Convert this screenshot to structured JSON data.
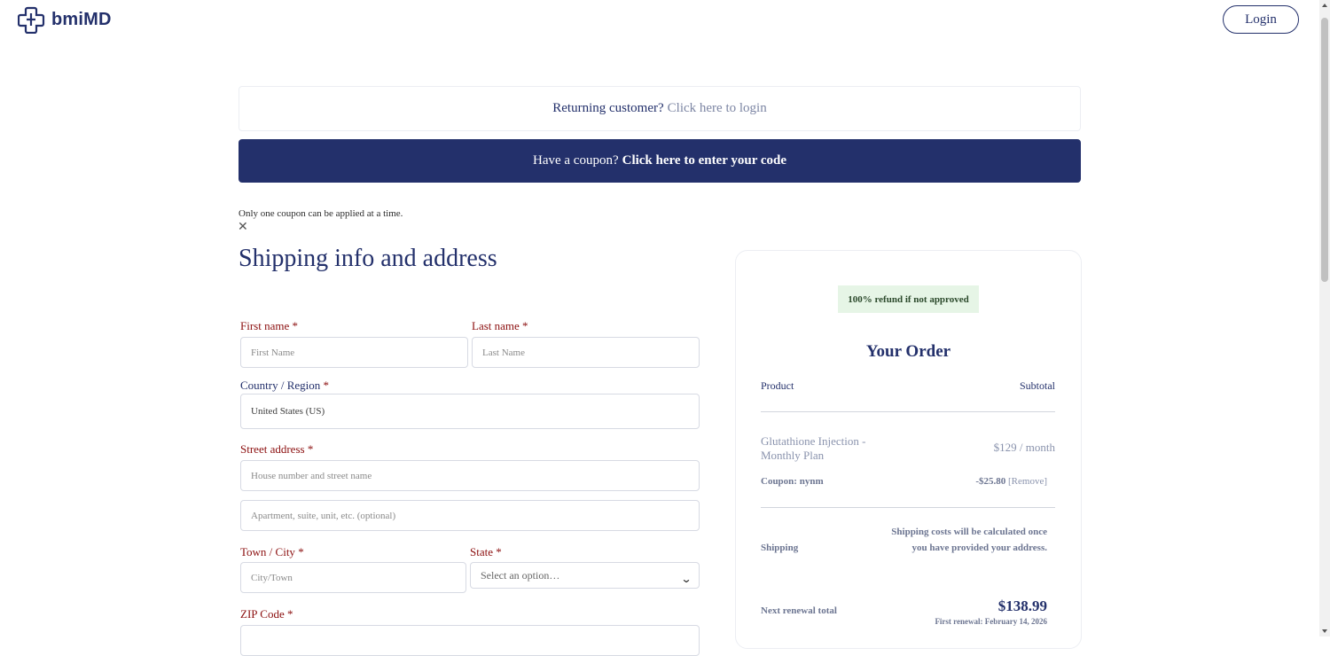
{
  "brand": {
    "name": "bmiMD",
    "logo_color": "#23306b"
  },
  "header": {
    "login_label": "Login"
  },
  "returning": {
    "question": "Returning customer?",
    "link": "Click here to login"
  },
  "coupon": {
    "question": "Have a coupon?",
    "link": "Click here to enter your code",
    "note": "Only one coupon can be applied at a time.",
    "close_icon": "close-icon",
    "bar_color": "#23306b"
  },
  "form": {
    "title": "Shipping info and address",
    "first_name": {
      "label": "First name",
      "required": "*",
      "placeholder": "First Name"
    },
    "last_name": {
      "label": "Last name",
      "required": "*",
      "placeholder": "Last Name"
    },
    "country": {
      "label": "Country / Region",
      "required": "*",
      "value": "United States (US)"
    },
    "street": {
      "label": "Street address",
      "required": "*",
      "placeholder": "House number and street name",
      "placeholder2": "Apartment, suite, unit, etc. (optional)"
    },
    "city": {
      "label": "Town / City",
      "required": "*",
      "placeholder": "City/Town"
    },
    "state": {
      "label": "State",
      "required": "*",
      "value": "Select an option…"
    },
    "zip": {
      "label": "ZIP Code",
      "required": "*"
    }
  },
  "order": {
    "badge": "100% refund if not approved",
    "title": "Your Order",
    "col_product": "Product",
    "col_subtotal": "Subtotal",
    "product_name": "Glutathione Injection - Monthly Plan",
    "product_price": "$129 / month",
    "coupon_label": "Coupon: nynm",
    "coupon_amount": "-$25.80",
    "coupon_remove": "[Remove]",
    "shipping_label": "Shipping",
    "shipping_note": "Shipping costs will be calculated once you have provided your address.",
    "renewal_label": "Next renewal total",
    "renewal_total": "$138.99",
    "renewal_date": "First renewal: February 14, 2026"
  }
}
